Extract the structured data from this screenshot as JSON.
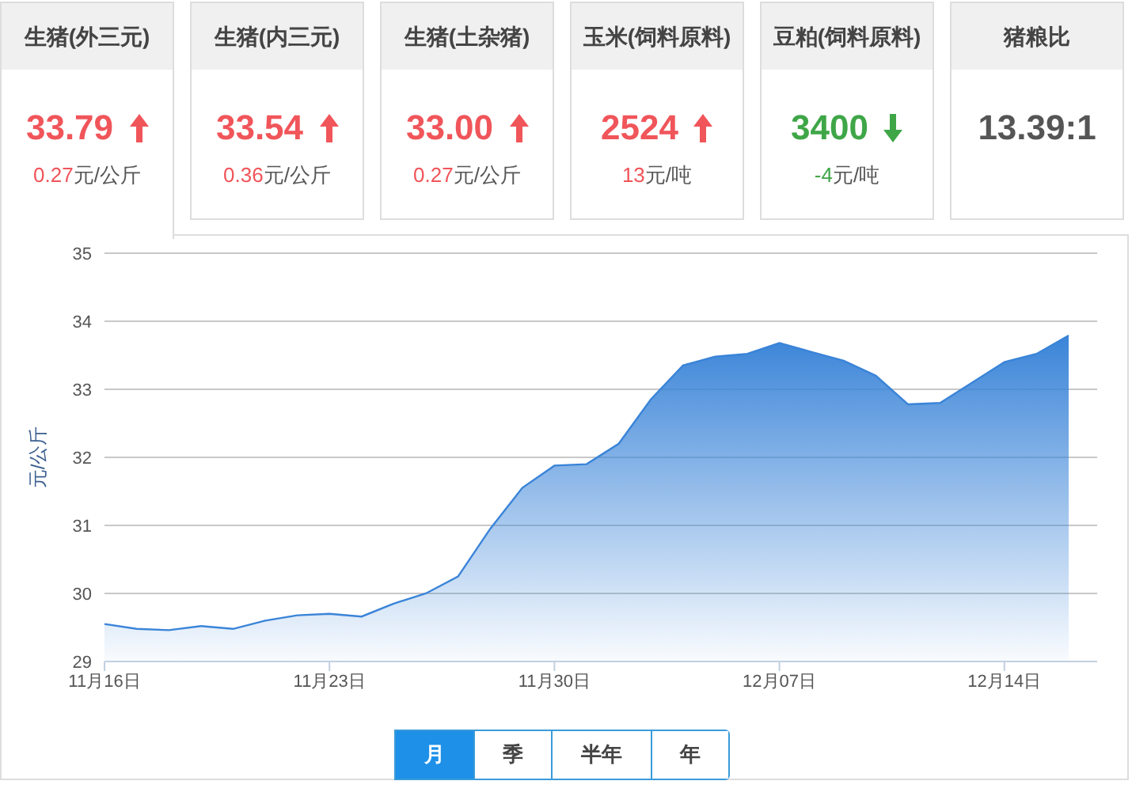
{
  "cards": [
    {
      "title": "生猪(外三元)",
      "value": "33.79",
      "kind": "up",
      "change": "0.27",
      "unit": "元/公斤",
      "selected": true
    },
    {
      "title": "生猪(内三元)",
      "value": "33.54",
      "kind": "up",
      "change": "0.36",
      "unit": "元/公斤",
      "selected": false
    },
    {
      "title": "生猪(土杂猪)",
      "value": "33.00",
      "kind": "up",
      "change": "0.27",
      "unit": "元/公斤",
      "selected": false
    },
    {
      "title": "玉米(饲料原料)",
      "value": "2524",
      "kind": "up",
      "change": "13",
      "unit": "元/吨",
      "selected": false
    },
    {
      "title": "豆粕(饲料原料)",
      "value": "3400",
      "kind": "down",
      "change": "-4",
      "unit": "元/吨",
      "selected": false
    },
    {
      "title": "猪粮比",
      "value": "13.39:1",
      "kind": "plain",
      "selected": false
    }
  ],
  "chart": {
    "chart_data": {
      "type": "area",
      "ylabel": "元/公斤",
      "categories": [
        "11月16日",
        null,
        null,
        null,
        null,
        null,
        null,
        "11月23日",
        null,
        null,
        null,
        null,
        null,
        null,
        "11月30日",
        null,
        null,
        null,
        null,
        null,
        null,
        "12月07日",
        null,
        null,
        null,
        null,
        null,
        null,
        "12月14日",
        null,
        null
      ],
      "series": [
        {
          "color": "#3a84d8",
          "values": [
            29.55,
            29.48,
            29.46,
            29.52,
            29.48,
            29.6,
            29.68,
            29.7,
            29.66,
            29.85,
            30.0,
            30.25,
            30.95,
            31.55,
            31.88,
            31.9,
            32.2,
            32.85,
            33.35,
            33.48,
            33.52,
            33.68,
            33.55,
            33.42,
            33.2,
            32.78,
            32.8,
            33.1,
            33.4,
            33.52,
            33.79
          ]
        }
      ],
      "ylim": [
        29,
        35
      ],
      "grid": true,
      "yticks": [
        29,
        30,
        31,
        32,
        33,
        34,
        35
      ]
    }
  },
  "periods": [
    {
      "label": "月",
      "selected": true
    },
    {
      "label": "季",
      "selected": false
    },
    {
      "label": "半年",
      "selected": false
    },
    {
      "label": "年",
      "selected": false
    }
  ]
}
